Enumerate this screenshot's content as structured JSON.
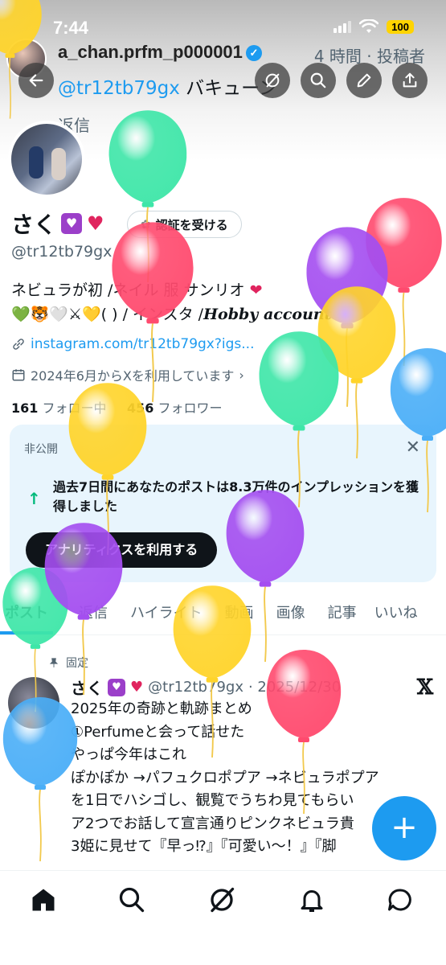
{
  "status_bar": {
    "time": "7:44",
    "battery": "100"
  },
  "notification": {
    "username": "a_chan.prfm_p000001",
    "meta": "4 時間 · 投稿者",
    "mention": "@tr12tb79gx",
    "text": " バキューン",
    "reply_label": "返信"
  },
  "header_buttons": [
    "back-icon",
    "grok-icon",
    "search-icon",
    "edit-icon",
    "share-icon"
  ],
  "profile": {
    "name": "さく",
    "verify_button": "認証を受ける",
    "handle": "@tr12tb79gx",
    "bio_line1": "ネビュラが初 /ネイル 服 サンリオ ",
    "bio_line2": "( ) / インスタ /",
    "bio_italic": "Hobby account",
    "link": "instagram.com/tr12tb79gx?igs...",
    "joined": "2024年6月からXを利用しています",
    "following_count": "161",
    "following_label": "フォロー中",
    "followers_count": "456",
    "followers_label": "フォロワー"
  },
  "analytics_card": {
    "label": "非公開",
    "text": "過去7日間にあなたのポストは8.3万件のインプレッションを獲得しました",
    "button": "アナリティクスを利用する"
  },
  "tabs": [
    "ポスト",
    "返信",
    "ハイライト",
    "動画",
    "画像",
    "記事",
    "いいね"
  ],
  "post": {
    "pinned_label": "固定",
    "name": "さく",
    "handle": "@tr12tb79gx",
    "date": "· 2025/12/30",
    "body": "2025年の奇跡と軌跡まとめ\n①Perfumeと会って話せた\nやっぱ今年はこれ\nぽかぽか →パフュクロポプア →ネビュラポプア\nを1日でハシゴし、観覧でうちわ見てもらい\nア2つでお話して宣言通りピンクネビュラ貴\n3姫に見せて『早っ⁉』『可愛い〜！』『脚"
  },
  "fab": "+",
  "bottom_nav": [
    "home-icon",
    "search-icon",
    "grok-icon",
    "notifications-icon",
    "messages-icon"
  ],
  "colors": {
    "accent": "#1d9bf0",
    "text": "#0f1419",
    "muted": "#536471",
    "card": "#e8f5fd"
  },
  "balloons": [
    {
      "color": "#ffd42a"
    },
    {
      "color": "#3ee6a8"
    },
    {
      "color": "#ff4a6e"
    },
    {
      "color": "#ff4a6e"
    },
    {
      "color": "#a44ef0"
    },
    {
      "color": "#ffd42a"
    },
    {
      "color": "#3ee6a8"
    },
    {
      "color": "#4aaef7"
    },
    {
      "color": "#ffd42a"
    },
    {
      "color": "#a44ef0"
    },
    {
      "color": "#3ee6a8"
    },
    {
      "color": "#a44ef0"
    },
    {
      "color": "#ffd42a"
    },
    {
      "color": "#ff4a6e"
    },
    {
      "color": "#4aaef7"
    }
  ]
}
